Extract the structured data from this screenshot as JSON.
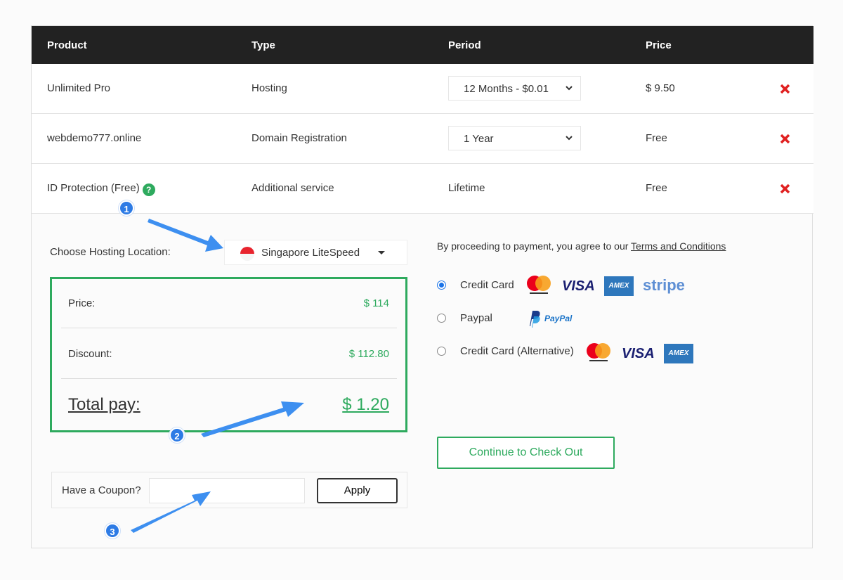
{
  "table": {
    "headers": [
      "Product",
      "Type",
      "Period",
      "Price"
    ],
    "rows": [
      {
        "product": "Unlimited Pro",
        "type": "Hosting",
        "period": "12 Months - $0.01",
        "period_is_select": true,
        "price": "$ 9.50"
      },
      {
        "product": "webdemo777.online",
        "type": "Domain Registration",
        "period": "1 Year",
        "period_is_select": true,
        "price": "Free"
      },
      {
        "product": "ID Protection (Free)",
        "type": "Additional service",
        "period": "Lifetime",
        "period_is_select": false,
        "price": "Free",
        "help_icon": "?"
      }
    ]
  },
  "location": {
    "label": "Choose Hosting Location:",
    "value": "Singapore LiteSpeed",
    "flag": "singapore-flag-icon"
  },
  "summary": {
    "price_label": "Price:",
    "price_value": "$ 114",
    "discount_label": "Discount:",
    "discount_value": "$ 112.80",
    "total_label": "Total pay:",
    "total_value": "$ 1.20"
  },
  "coupon": {
    "label": "Have a Coupon?",
    "input_value": "",
    "placeholder": "",
    "apply_label": "Apply"
  },
  "payment": {
    "terms_prefix": "By proceeding to payment, you agree to our ",
    "terms_link": "Terms and Conditions",
    "methods": [
      {
        "label": "Credit Card",
        "selected": true,
        "logos": [
          "mastercard",
          "VISA",
          "AMEX",
          "stripe"
        ]
      },
      {
        "label": "Paypal",
        "selected": false,
        "logos": [
          "PayPal"
        ]
      },
      {
        "label": "Credit Card (Alternative)",
        "selected": false,
        "logos": [
          "mastercard",
          "VISA",
          "AMEX"
        ]
      }
    ],
    "checkout_label": "Continue to Check Out"
  },
  "annotations": [
    "1",
    "2",
    "3"
  ],
  "colors": {
    "header_bg": "#222222",
    "accent_green": "#2eaa5e",
    "remove_red": "#e02020",
    "annotation_blue": "#2d7be5"
  }
}
